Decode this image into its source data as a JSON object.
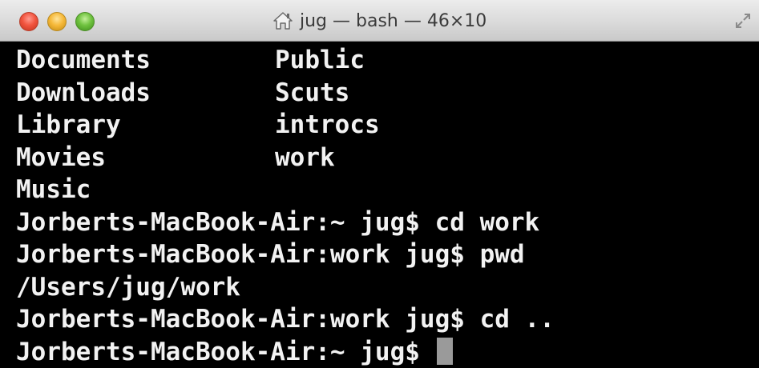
{
  "window": {
    "title": "jug — bash — 46×10",
    "icons": {
      "home": "home-icon",
      "resize": "resize-icon"
    },
    "traffic_lights": [
      "close",
      "minimize",
      "zoom"
    ]
  },
  "terminal": {
    "listing": [
      {
        "left": "Documents",
        "right": "Public"
      },
      {
        "left": "Downloads",
        "right": "Scuts"
      },
      {
        "left": "Library",
        "right": "introcs"
      },
      {
        "left": "Movies",
        "right": "work"
      },
      {
        "left": "Music",
        "right": ""
      }
    ],
    "lines": [
      "Jorberts-MacBook-Air:~ jug$ cd work",
      "Jorberts-MacBook-Air:work jug$ pwd",
      "/Users/jug/work",
      "Jorberts-MacBook-Air:work jug$ cd ..",
      "Jorberts-MacBook-Air:~ jug$ "
    ],
    "colors": {
      "background": "#000000",
      "text": "#f2f2f2",
      "cursor": "#9a9a9a"
    }
  }
}
